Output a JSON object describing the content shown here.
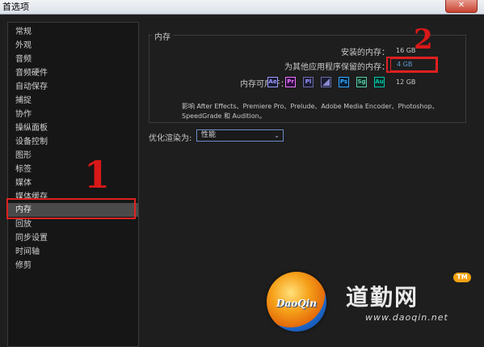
{
  "window": {
    "title": "首选项",
    "close_glyph": "✕"
  },
  "sidebar": {
    "items": [
      {
        "label": "常规"
      },
      {
        "label": "外观"
      },
      {
        "label": "音频"
      },
      {
        "label": "音频硬件"
      },
      {
        "label": "自动保存"
      },
      {
        "label": "捕捉"
      },
      {
        "label": "协作"
      },
      {
        "label": "操纵面板"
      },
      {
        "label": "设备控制"
      },
      {
        "label": "图形"
      },
      {
        "label": "标签"
      },
      {
        "label": "媒体"
      },
      {
        "label": "媒体缓存"
      },
      {
        "label": "内存",
        "selected": true
      },
      {
        "label": "回放"
      },
      {
        "label": "同步设置"
      },
      {
        "label": "时间轴"
      },
      {
        "label": "修剪"
      }
    ]
  },
  "memory": {
    "section_title": "内存",
    "installed_label": "安装的内存：",
    "installed_value": "16 GB",
    "reserved_label": "为其他应用程序保留的内存：",
    "reserved_value": "4 GB",
    "available_label": "内存可用于：",
    "available_value": "12 GB",
    "apps": [
      {
        "abbr": "Ae",
        "color": "#9999ff",
        "icon": "after-effects-icon"
      },
      {
        "abbr": "Pr",
        "color": "#ea77ff",
        "icon": "premiere-pro-icon"
      },
      {
        "abbr": "Pl",
        "color": "#9999ff",
        "icon": "prelude-icon"
      },
      {
        "abbr": "",
        "color": "#9999ff",
        "icon": "media-encoder-icon"
      },
      {
        "abbr": "Ps",
        "color": "#31a8ff",
        "icon": "photoshop-icon"
      },
      {
        "abbr": "Sg",
        "color": "#5fc9a8",
        "icon": "speedgrade-icon"
      },
      {
        "abbr": "Au",
        "color": "#00c8a8",
        "icon": "audition-icon"
      }
    ],
    "affects_text": "影响 After Effects、Premiere Pro、Prelude、Adobe Media Encoder、Photoshop、SpeedGrade 和 Audition。"
  },
  "render": {
    "label": "优化渲染为:",
    "selected": "性能"
  },
  "annotations": {
    "mark1": "1",
    "mark2": "2",
    "annotation_color": "#e02020"
  },
  "watermark": {
    "logo_text": "DaoQin",
    "brand_cn": "道勤网",
    "tm": "TM",
    "url": "www.daoqin.net"
  }
}
